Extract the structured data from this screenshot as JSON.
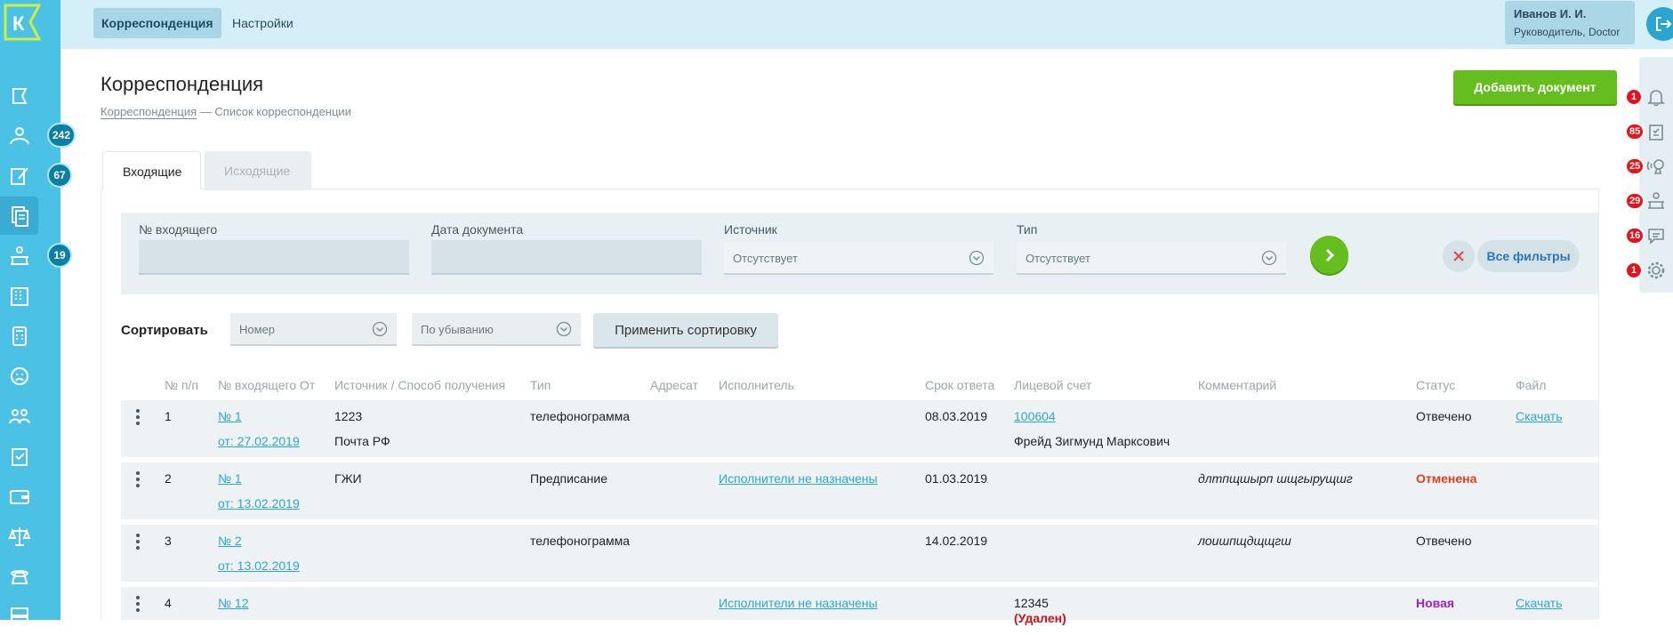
{
  "app": {
    "logo_letter": "К"
  },
  "leftnav": {
    "items": [
      {
        "icon": "flag-icon"
      },
      {
        "icon": "people-icon",
        "badge": "242"
      },
      {
        "icon": "edit-doc-icon",
        "badge": "67"
      },
      {
        "icon": "documents-icon",
        "active": true
      },
      {
        "icon": "desk-icon",
        "badge": "19"
      },
      {
        "icon": "building-icon"
      },
      {
        "icon": "calculator-icon"
      },
      {
        "icon": "sad-face-icon"
      },
      {
        "icon": "group-icon"
      },
      {
        "icon": "clipboard-check-icon"
      },
      {
        "icon": "wallet-icon"
      },
      {
        "icon": "scales-icon"
      },
      {
        "icon": "phone-icon"
      },
      {
        "icon": "server-icon"
      }
    ]
  },
  "topbar": {
    "tabs": [
      "Корреспонденция",
      "Настройки"
    ],
    "user_name": "Иванов И. И.",
    "user_role": "Руководитель, Doctor"
  },
  "page": {
    "title": "Корреспонденция",
    "crumb_link": "Корреспонденция",
    "crumb_sep": " — ",
    "crumb_current": "Список корреспонденции",
    "add_button": "Добавить документ"
  },
  "rightbar": [
    {
      "icon": "bell-icon",
      "badge": "1"
    },
    {
      "icon": "clipboard-icon",
      "badge": "85"
    },
    {
      "icon": "speaker-icon",
      "badge": "25"
    },
    {
      "icon": "desk-icon",
      "badge": "29"
    },
    {
      "icon": "chat-icon",
      "badge": "16"
    },
    {
      "icon": "gear-icon",
      "badge": "1"
    }
  ],
  "direction_tabs": [
    "Входящие",
    "Исходящие"
  ],
  "filters": {
    "incoming_no_label": "№ входящего",
    "incoming_no_value": "",
    "doc_date_label": "Дата документа",
    "doc_date_value": "",
    "source_label": "Источник",
    "source_value": "Отсутствует",
    "type_label": "Тип",
    "type_value": "Отсутствует",
    "all_filters": "Все фильтры"
  },
  "sort": {
    "label": "Сортировать",
    "field": "Номер",
    "order": "По убыванию",
    "apply": "Применить сортировку"
  },
  "table": {
    "headers": [
      "№ п/п",
      "№ входящего От",
      "Источник / Способ получения",
      "Тип",
      "Адресат",
      "Исполнитель",
      "Срок ответа",
      "Лицевой счет",
      "Комментарий",
      "Статус",
      "Файл"
    ],
    "rows": [
      {
        "n": "1",
        "num": "№ 1",
        "from": "от: 27.02.2019",
        "source": "1223",
        "method": "Почта РФ",
        "type": "телефонограмма",
        "executor": "",
        "deadline": "08.03.2019",
        "account": "100604",
        "account_name": "Фрейд Зигмунд Марксович",
        "comment": "",
        "status": "Отвечено",
        "status_kind": "normal",
        "file": "Скачать"
      },
      {
        "n": "2",
        "num": "№ 1",
        "from": "от: 13.02.2019",
        "source": "ГЖИ",
        "method": "",
        "type": "Предписание",
        "executor": "Исполнители не назначены",
        "deadline": "01.03.2019",
        "account": "",
        "account_name": "",
        "comment": "длтпщшырп шщгырущшг",
        "status": "Отменена",
        "status_kind": "red",
        "file": ""
      },
      {
        "n": "3",
        "num": "№ 2",
        "from": "от: 13.02.2019",
        "source": "",
        "method": "",
        "type": "телефонограмма",
        "executor": "",
        "deadline": "14.02.2019",
        "account": "",
        "account_name": "",
        "comment": "лоишпщдщщгш",
        "status": "Отвечено",
        "status_kind": "normal",
        "file": ""
      },
      {
        "n": "4",
        "num": "№ 12",
        "from": "",
        "source": "",
        "method": "",
        "type": "",
        "executor": "Исполнители не назначены",
        "deadline": "",
        "account_plain": "12345",
        "account_deleted": "(Удален)",
        "comment": "",
        "status": "Новая",
        "status_kind": "purple",
        "file": "Скачать"
      }
    ]
  },
  "colors": {
    "sidebar": "#4cc1e6",
    "accent_green": "#64be1d",
    "link": "#2aa8cf",
    "badge_red": "#e8121c"
  }
}
